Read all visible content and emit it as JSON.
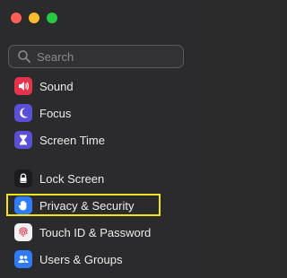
{
  "window": {
    "traffic_lights": [
      "close",
      "minimize",
      "zoom"
    ]
  },
  "search": {
    "placeholder": "Search",
    "value": ""
  },
  "sidebar": {
    "items": [
      {
        "label": "Sound",
        "icon": "sound-icon",
        "color": "#e5334b"
      },
      {
        "label": "Focus",
        "icon": "moon-icon",
        "color": "#5b4fd6"
      },
      {
        "label": "Screen Time",
        "icon": "hourglass-icon",
        "color": "#5b4fd6"
      },
      {
        "label": "Lock Screen",
        "icon": "lock-icon",
        "color": "#1c1c1e"
      },
      {
        "label": "Privacy & Security",
        "icon": "hand-icon",
        "color": "#2f7cf6"
      },
      {
        "label": "Touch ID & Password",
        "icon": "fingerprint-icon",
        "color": "#f2f2f2"
      },
      {
        "label": "Users & Groups",
        "icon": "users-icon",
        "color": "#2f7cf6"
      }
    ]
  },
  "highlight_color": "#f1e51a"
}
